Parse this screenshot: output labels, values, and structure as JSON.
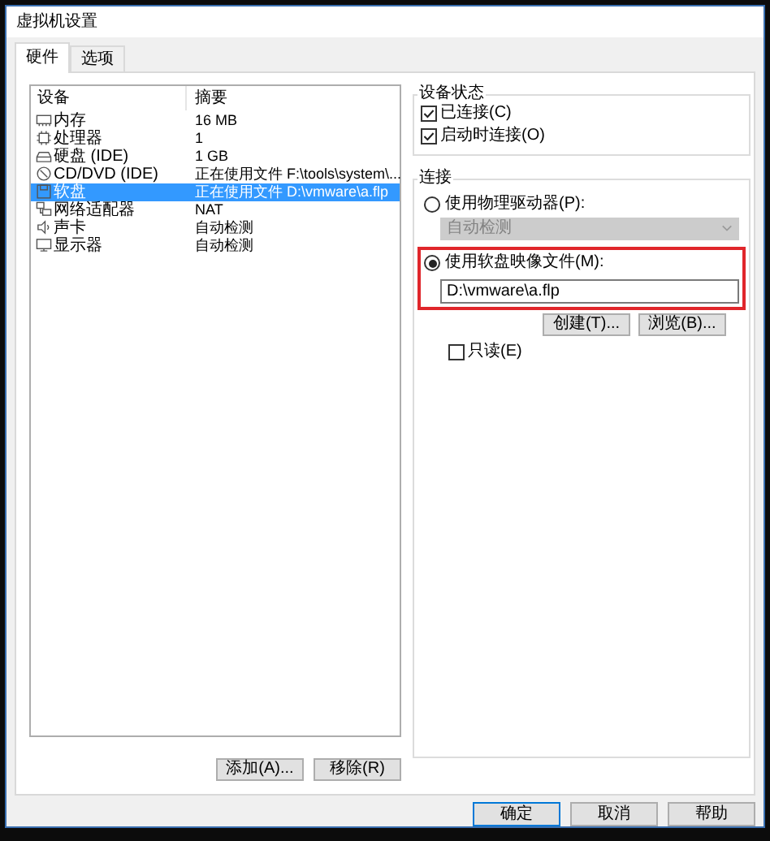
{
  "window": {
    "title": "虚拟机设置"
  },
  "tabs": [
    {
      "label": "硬件",
      "selected": true
    },
    {
      "label": "选项",
      "selected": false
    }
  ],
  "devices": {
    "columns": [
      "设备",
      "摘要"
    ],
    "rows": [
      {
        "kind": "memory",
        "name": "内存",
        "summary": "16 MB",
        "selected": false
      },
      {
        "kind": "cpu",
        "name": "处理器",
        "summary": "1",
        "selected": false
      },
      {
        "kind": "disk",
        "name": "硬盘 (IDE)",
        "summary": "1 GB",
        "selected": false
      },
      {
        "kind": "cd",
        "name": "CD/DVD (IDE)",
        "summary": "正在使用文件 F:\\tools\\system\\...",
        "selected": false
      },
      {
        "kind": "floppy",
        "name": "软盘",
        "summary": "正在使用文件 D:\\vmware\\a.flp",
        "selected": true
      },
      {
        "kind": "network",
        "name": "网络适配器",
        "summary": "NAT",
        "selected": false
      },
      {
        "kind": "sound",
        "name": "声卡",
        "summary": "自动检测",
        "selected": false
      },
      {
        "kind": "display",
        "name": "显示器",
        "summary": "自动检测",
        "selected": false
      }
    ],
    "buttons": [
      "添加(A)...",
      "移除(R)"
    ]
  },
  "device_status": {
    "title": "设备状态",
    "checkboxes": [
      {
        "label": "已连接(C)",
        "checked": true
      },
      {
        "label": "启动时连接(O)",
        "checked": true
      }
    ]
  },
  "connection": {
    "title": "连接",
    "options": [
      {
        "label": "使用物理驱动器(P):",
        "selected": false,
        "highlighted": false
      },
      {
        "label": "使用软盘映像文件(M):",
        "selected": true,
        "highlighted": true
      }
    ],
    "drive_dropdown": {
      "value": "自动检测",
      "disabled": true
    },
    "image_file": {
      "value": "D:\\vmware\\a.flp"
    },
    "buttons": [
      "创建(T)...",
      "浏览(B)..."
    ],
    "read_only": {
      "label": "只读(E)",
      "checked": false
    }
  },
  "dialog_buttons": [
    {
      "label": "确定",
      "default": true
    },
    {
      "label": "取消",
      "default": false
    },
    {
      "label": "帮助",
      "default": false
    }
  ]
}
